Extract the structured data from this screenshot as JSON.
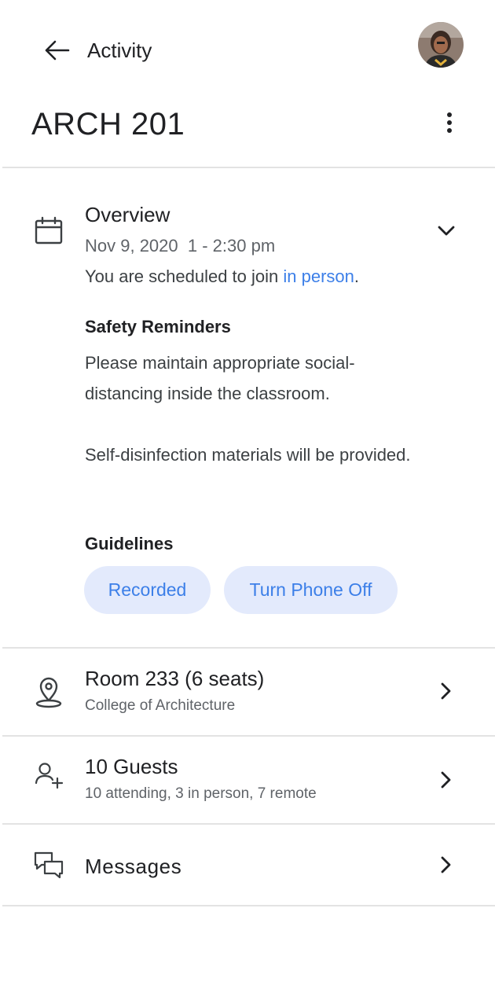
{
  "header": {
    "title": "Activity"
  },
  "course": {
    "title": "ARCH 201"
  },
  "overview": {
    "title": "Overview",
    "date": "Nov 9, 2020  1 - 2:30 pm",
    "schedule_prefix": "You are scheduled to join ",
    "schedule_link": "in person",
    "schedule_suffix": ".",
    "safety_heading": "Safety Reminders",
    "safety_text_1": "Please maintain appropriate social-distancing inside the classroom.",
    "safety_text_2": "Self-disinfection materials will be provided.",
    "guidelines_heading": "Guidelines",
    "chips": [
      "Recorded",
      "Turn Phone Off"
    ]
  },
  "location": {
    "title": "Room 233 (6 seats)",
    "subtitle": "College of Architecture"
  },
  "guests": {
    "title": "10 Guests",
    "subtitle": "10 attending, 3 in person, 7 remote"
  },
  "messages": {
    "title": "Messages"
  },
  "colors": {
    "accent": "#3c7fe8",
    "chip_bg": "#e3eafc",
    "divider": "#e3e3e3"
  }
}
